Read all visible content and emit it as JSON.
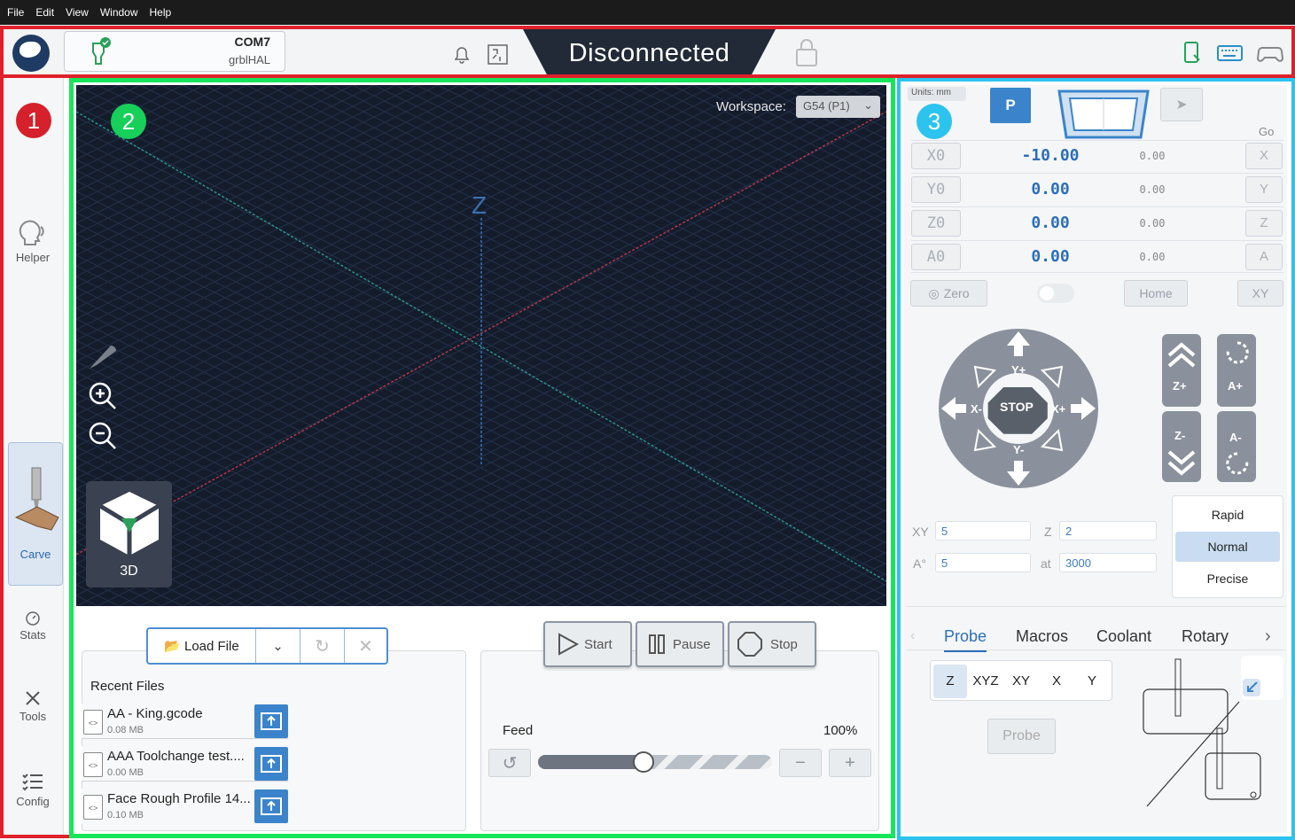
{
  "menu": [
    "File",
    "Edit",
    "View",
    "Window",
    "Help"
  ],
  "header": {
    "port": "COM7",
    "firmware": "grblHAL",
    "status": "Disconnected"
  },
  "badges": [
    "1",
    "2",
    "3"
  ],
  "sidebar": {
    "items": [
      {
        "label": "Helper",
        "icon": "helper-icon"
      },
      {
        "label": "Carve",
        "icon": "carve-icon"
      },
      {
        "label": "Stats",
        "icon": "gauge-icon"
      },
      {
        "label": "Tools",
        "icon": "tools-icon"
      },
      {
        "label": "Config",
        "icon": "config-icon"
      }
    ]
  },
  "visualizer": {
    "workspace_label": "Workspace:",
    "workspace_value": "G54 (P1)",
    "z_axis_label": "Z",
    "view_label": "3D"
  },
  "files": {
    "load_label": "Load File",
    "recent_title": "Recent Files",
    "recent": [
      {
        "name": "AA - King.gcode",
        "size": "0.08 MB"
      },
      {
        "name": "AAA Toolchange test....",
        "size": "0.00 MB"
      },
      {
        "name": "Face Rough Profile 14...",
        "size": "0.10 MB"
      }
    ]
  },
  "job": {
    "start": "Start",
    "pause": "Pause",
    "stop": "Stop",
    "feed_label": "Feed",
    "feed_value": "100%"
  },
  "location": {
    "units": "Units: mm",
    "p_label": "P",
    "go_label": "Go",
    "axes": [
      {
        "name": "X0",
        "value": "-10.00",
        "mpos": "0.00",
        "go": "X"
      },
      {
        "name": "Y0",
        "value": "0.00",
        "mpos": "0.00",
        "go": "Y"
      },
      {
        "name": "Z0",
        "value": "0.00",
        "mpos": "0.00",
        "go": "Z"
      },
      {
        "name": "A0",
        "value": "0.00",
        "mpos": "0.00",
        "go": "A"
      }
    ],
    "zero": "Zero",
    "home": "Home",
    "xy": "XY"
  },
  "jog": {
    "stop": "STOP",
    "yplus": "Y+",
    "yminus": "Y-",
    "xplus": "X+",
    "xminus": "X-",
    "zplus": "Z+",
    "zminus": "Z-",
    "aplus": "A+",
    "aminus": "A-",
    "xy_label": "XY",
    "xy_value": "5",
    "z_label": "Z",
    "z_value": "2",
    "a_label": "A°",
    "a_value": "5",
    "at_label": "at",
    "at_value": "3000",
    "speeds": [
      "Rapid",
      "Normal",
      "Precise"
    ]
  },
  "tools_tabs": [
    "Probe",
    "Macros",
    "Coolant",
    "Rotary"
  ],
  "probe": {
    "options": [
      "Z",
      "XYZ",
      "XY",
      "X",
      "Y"
    ],
    "button": "Probe"
  }
}
